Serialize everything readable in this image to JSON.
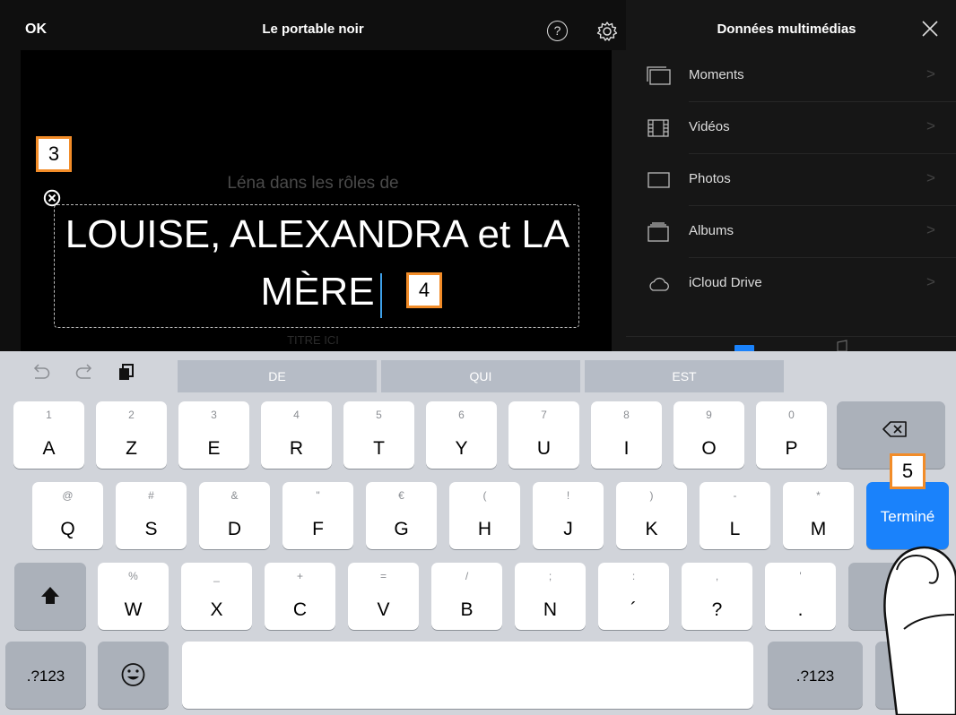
{
  "editor": {
    "ok_label": "OK",
    "project_title": "Le portable noir",
    "help_label": "?",
    "subtitle_text": "Léna dans les rôles de",
    "title_line1": "LOUISE, ALEXANDRA et LA",
    "title_line2": "MÈRE",
    "lower_subtitle": "TITRE ICI"
  },
  "callouts": {
    "c3": "3",
    "c4": "4",
    "c5": "5"
  },
  "media_panel": {
    "title": "Données multimédias",
    "items": [
      {
        "label": "Moments",
        "icon": "moments-icon"
      },
      {
        "label": "Vidéos",
        "icon": "film-icon"
      },
      {
        "label": "Photos",
        "icon": "photo-icon"
      },
      {
        "label": "Albums",
        "icon": "albums-icon"
      },
      {
        "label": "iCloud Drive",
        "icon": "cloud-icon"
      }
    ],
    "chevron": ">"
  },
  "keyboard": {
    "suggestions": [
      "DE",
      "QUI",
      "EST"
    ],
    "row1": [
      {
        "main": "A",
        "alt": "1"
      },
      {
        "main": "Z",
        "alt": "2"
      },
      {
        "main": "E",
        "alt": "3"
      },
      {
        "main": "R",
        "alt": "4"
      },
      {
        "main": "T",
        "alt": "5"
      },
      {
        "main": "Y",
        "alt": "6"
      },
      {
        "main": "U",
        "alt": "7"
      },
      {
        "main": "I",
        "alt": "8"
      },
      {
        "main": "O",
        "alt": "9"
      },
      {
        "main": "P",
        "alt": "0"
      }
    ],
    "row2": [
      {
        "main": "Q",
        "alt": "@"
      },
      {
        "main": "S",
        "alt": "#"
      },
      {
        "main": "D",
        "alt": "&"
      },
      {
        "main": "F",
        "alt": "\""
      },
      {
        "main": "G",
        "alt": "€"
      },
      {
        "main": "H",
        "alt": "("
      },
      {
        "main": "J",
        "alt": "!"
      },
      {
        "main": "K",
        "alt": ")"
      },
      {
        "main": "L",
        "alt": "-"
      },
      {
        "main": "M",
        "alt": "*"
      }
    ],
    "row3": [
      {
        "main": "W",
        "alt": "%"
      },
      {
        "main": "X",
        "alt": "_"
      },
      {
        "main": "C",
        "alt": "+"
      },
      {
        "main": "V",
        "alt": "="
      },
      {
        "main": "B",
        "alt": "/"
      },
      {
        "main": "N",
        "alt": ";"
      },
      {
        "main": "´",
        "alt": ":"
      },
      {
        "main": "?",
        "alt": ","
      },
      {
        "main": ".",
        "alt": "'"
      }
    ],
    "done_label": "Terminé",
    "numbers_label": ".?123",
    "numbers_label_right": ".?123",
    "accent_color": "#1a82fb"
  }
}
